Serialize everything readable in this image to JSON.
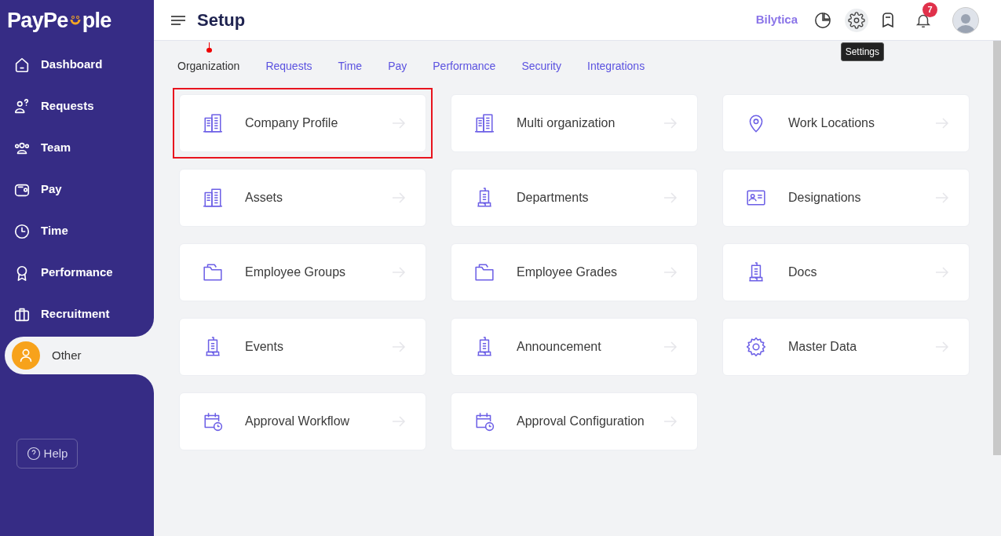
{
  "logo": {
    "text_a": "PayPe",
    "text_b": "ple"
  },
  "sidebar": {
    "items": [
      {
        "label": "Dashboard",
        "kind": "home",
        "selected": false
      },
      {
        "label": "Requests",
        "kind": "request",
        "selected": false
      },
      {
        "label": "Team",
        "kind": "team",
        "selected": false
      },
      {
        "label": "Pay",
        "kind": "wallet",
        "selected": false
      },
      {
        "label": "Time",
        "kind": "clock",
        "selected": false
      },
      {
        "label": "Performance",
        "kind": "award",
        "selected": false
      },
      {
        "label": "Recruitment",
        "kind": "briefcase",
        "selected": false
      },
      {
        "label": "Other",
        "kind": "user",
        "selected": true
      }
    ],
    "help": "Help"
  },
  "header": {
    "title": "Setup",
    "brand": "Bilytica",
    "notifications": "7",
    "tooltip": "Settings"
  },
  "tabs": [
    {
      "label": "Organization",
      "selected": true
    },
    {
      "label": "Requests",
      "selected": false
    },
    {
      "label": "Time",
      "selected": false
    },
    {
      "label": "Pay",
      "selected": false
    },
    {
      "label": "Performance",
      "selected": false
    },
    {
      "label": "Security",
      "selected": false
    },
    {
      "label": "Integrations",
      "selected": false
    }
  ],
  "cards": [
    {
      "label": "Company Profile",
      "kind": "buildings",
      "highlighted": true
    },
    {
      "label": "Multi organization",
      "kind": "buildings",
      "highlighted": false
    },
    {
      "label": "Work Locations",
      "kind": "pin",
      "highlighted": false
    },
    {
      "label": "Assets",
      "kind": "buildings",
      "highlighted": false
    },
    {
      "label": "Departments",
      "kind": "tower",
      "highlighted": false
    },
    {
      "label": "Designations",
      "kind": "idcard",
      "highlighted": false
    },
    {
      "label": "Employee Groups",
      "kind": "folder",
      "highlighted": false
    },
    {
      "label": "Employee Grades",
      "kind": "folder",
      "highlighted": false
    },
    {
      "label": "Docs",
      "kind": "tower",
      "highlighted": false
    },
    {
      "label": "Events",
      "kind": "tower",
      "highlighted": false
    },
    {
      "label": "Announcement",
      "kind": "tower",
      "highlighted": false
    },
    {
      "label": "Master Data",
      "kind": "gear",
      "highlighted": false
    },
    {
      "label": "Approval Workflow",
      "kind": "calendar",
      "highlighted": false
    },
    {
      "label": "Approval Configuration",
      "kind": "calendar",
      "highlighted": false
    }
  ]
}
